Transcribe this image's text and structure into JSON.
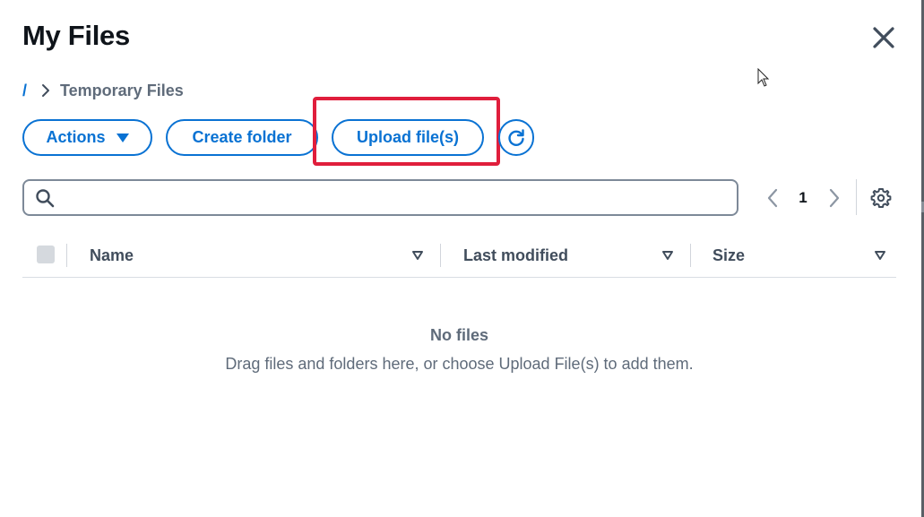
{
  "header": {
    "title": "My Files"
  },
  "breadcrumb": {
    "root": "/",
    "current": "Temporary Files"
  },
  "toolbar": {
    "actions_label": "Actions",
    "create_folder_label": "Create folder",
    "upload_label": "Upload file(s)"
  },
  "search": {
    "placeholder": "",
    "value": ""
  },
  "pagination": {
    "current_page": "1"
  },
  "table": {
    "columns": [
      "Name",
      "Last modified",
      "Size"
    ]
  },
  "empty_state": {
    "title": "No files",
    "description": "Drag files and folders here, or choose Upload File(s) to add them."
  },
  "icons": {
    "close": "close-icon",
    "breadcrumb_sep": "chevron-right-icon",
    "actions_caret": "caret-down-icon",
    "refresh": "refresh-icon",
    "search": "search-icon",
    "prev": "chevron-left-icon",
    "next": "chevron-right-icon",
    "settings": "gear-icon",
    "sort": "sort-down-icon"
  },
  "colors": {
    "accent": "#0972d3",
    "highlight": "#e01e3c",
    "text_primary": "#0f141a",
    "text_secondary": "#5f6b7a"
  }
}
